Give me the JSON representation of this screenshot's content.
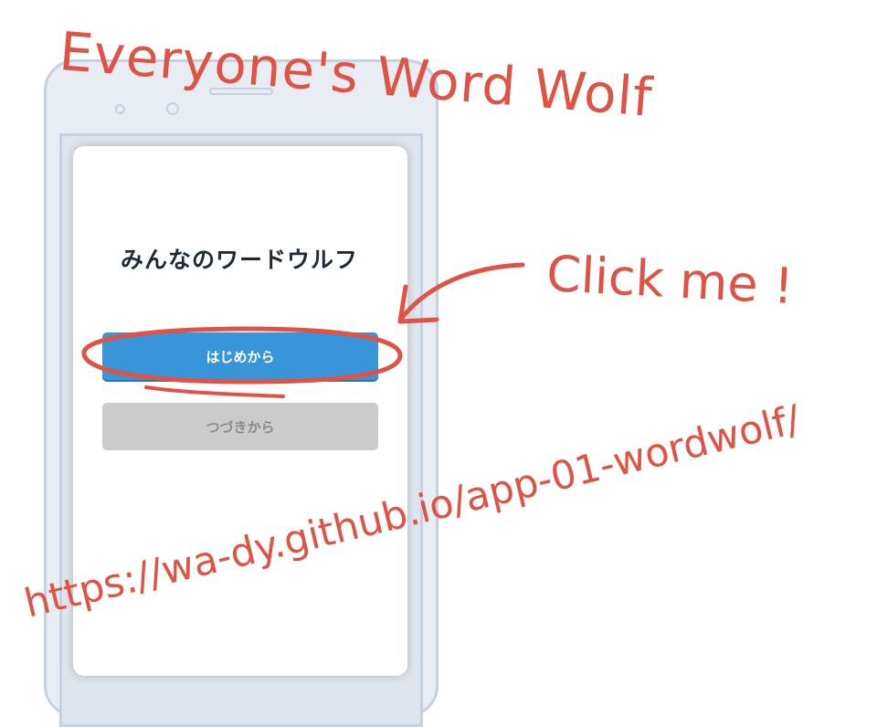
{
  "app": {
    "title": "みんなのワードウルフ",
    "start_button": "はじめから",
    "continue_button": "つづきから"
  },
  "annotations": {
    "headline": "Everyone's Word Wolf",
    "callout": "Click me !",
    "url": "https://wa-dy.github.io/app-01-wordwolf/"
  },
  "colors": {
    "annotation": "#e05244",
    "primary_button": "#3895da",
    "secondary_button": "#cbcbcb",
    "phone_frame": "#c3d1e0"
  }
}
